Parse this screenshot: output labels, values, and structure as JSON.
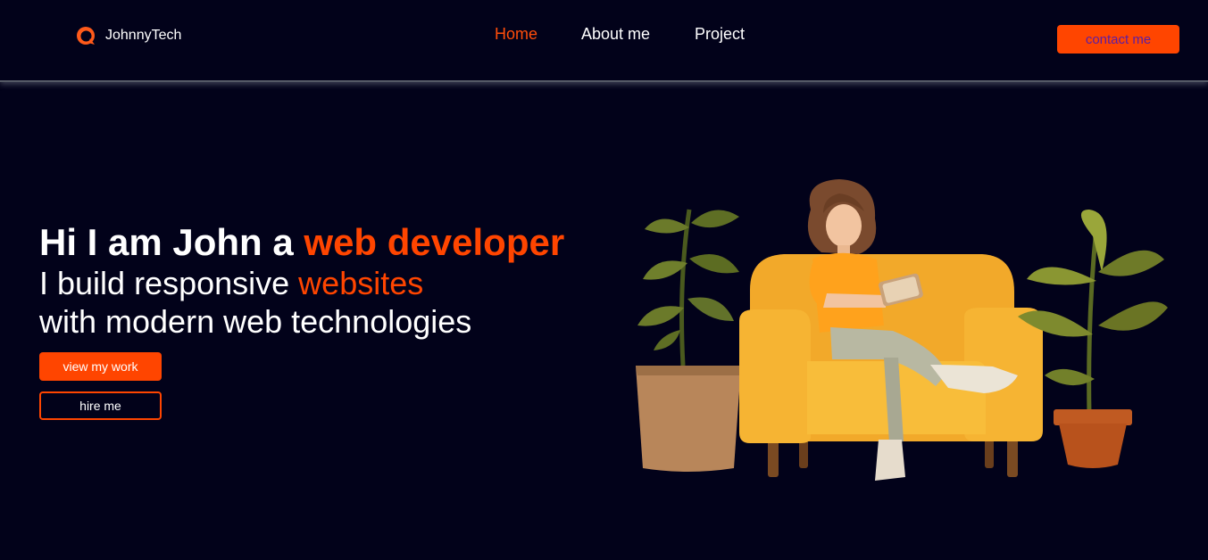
{
  "brand": {
    "name": "JohnnyTech",
    "icon": "logo-ring-icon"
  },
  "nav": [
    {
      "label": "Home",
      "active": true
    },
    {
      "label": "About me",
      "active": false
    },
    {
      "label": "Project",
      "active": false
    }
  ],
  "contact_label": "contact me",
  "hero": {
    "title_prefix": "Hi I am John a ",
    "title_accent": "web developer",
    "line1_prefix": "I build responsive ",
    "line1_accent": "websites",
    "line2": "with modern web technologies",
    "primary_label": "view my work",
    "secondary_label": "hire me",
    "illustration": "woman-reading-on-armchair-with-plants"
  },
  "colors": {
    "background": "#02021a",
    "accent": "#ff4500",
    "text": "#ffffff",
    "contact_text": "#5a1ea6"
  }
}
